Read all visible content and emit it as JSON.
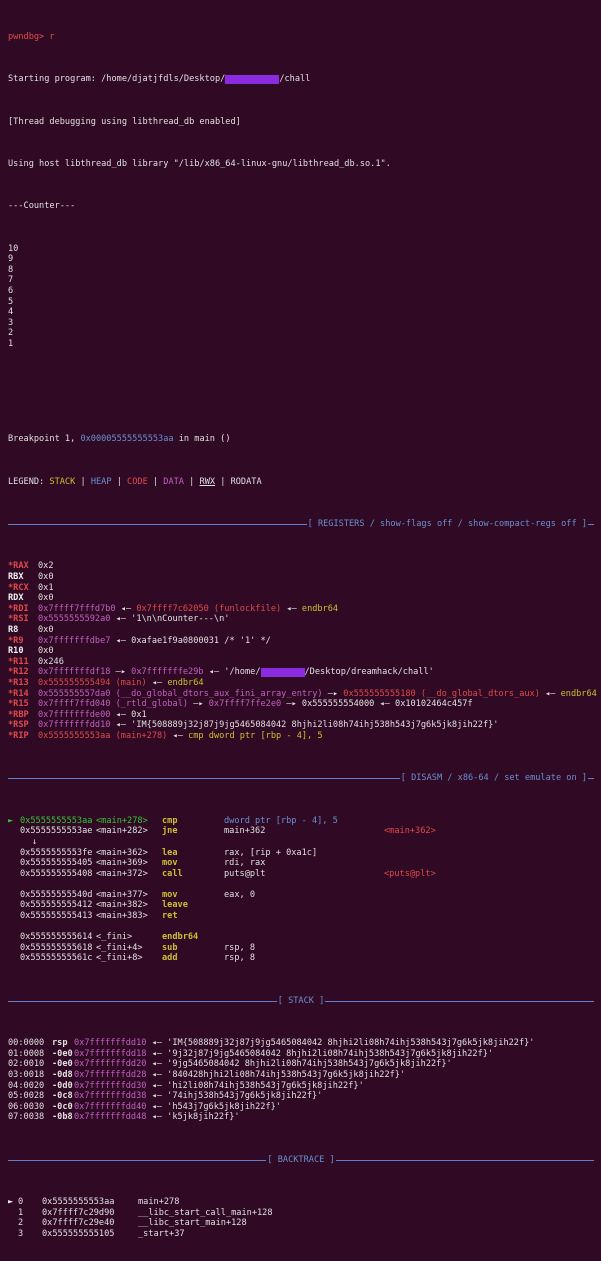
{
  "terminal": {
    "top_line": "pwndbg> r",
    "start_prefix": "Starting program: /home/djatjfdls/Desktop/",
    "start_suffix": "/chall",
    "thread_debug": "[Thread debugging using libthread_db enabled]",
    "host_libthread": "Using host libthread_db library \"/lib/x86_64-linux-gnu/libthread_db.so.1\".",
    "counter_header": "---Counter---",
    "counter_values": [
      "10",
      "9",
      "8",
      "7",
      "6",
      "5",
      "4",
      "3",
      "2",
      "1"
    ],
    "breakpoint_prefix": "Breakpoint 1, ",
    "breakpoint_addr": "0x00005555555553aa",
    "breakpoint_suffix": " in main ()",
    "legend_label": "LEGEND: ",
    "legend_items": [
      "STACK",
      "HEAP",
      "CODE",
      "DATA",
      "RWX",
      "RODATA"
    ]
  },
  "registers_header": "[ REGISTERS / show-flags off / show-compact-regs off ]",
  "registers": [
    {
      "name": "*RAX",
      "val": "0x2"
    },
    {
      "name": "RBX",
      "val": "0x0"
    },
    {
      "name": "*RCX",
      "val": "0x1"
    },
    {
      "name": "RDX",
      "val": "0x0"
    },
    {
      "name": "*RDI",
      "addr": "0x7ffff7fffd7b0",
      "arrow1": " ◂— ",
      "target": "0x7ffff7c62050 (funlockfile)",
      "arrow2": " ◂— ",
      "extra": "endbr64"
    },
    {
      "name": "*RSI",
      "addr": "0x5555555592a0",
      "arrow1": " ◂— ",
      "text": "'1\\n\\nCounter---\\n'"
    },
    {
      "name": "R8",
      "val": "0x0"
    },
    {
      "name": "*R9",
      "addr": "0x7fffffffdbe7",
      "arrow1": " ◂— ",
      "text": "0xafae1f9a0800031 /* '1' */"
    },
    {
      "name": "R10",
      "val": "0x0"
    },
    {
      "name": "*R11",
      "val": "0x246"
    },
    {
      "name": "*R12",
      "addr": "0x7fffffffdf18",
      "arrow1": " —▸ ",
      "target": "0x7fffffffe29b",
      "arrow2": " ◂— ",
      "text_prefix": "'/home/",
      "text_suffix": "/Desktop/dreamhack/chall'"
    },
    {
      "name": "*R13",
      "addr": "0x555555555494 (main)",
      "arrow1": " ◂— ",
      "extra": "endbr64"
    },
    {
      "name": "*R14",
      "addr": "0x555555557da0 (__do_global_dtors_aux_fini_array_entry)",
      "arrow1": " —▸ ",
      "target": "0x555555555180 (__do_global_dtors_aux)",
      "arrow2": " ◂— ",
      "extra": "endbr64"
    },
    {
      "name": "*R15",
      "addr": "0x7ffff7ffd040 (_rtld_global)",
      "arrow1": " —▸ ",
      "target": "0x7ffff7ffe2e0",
      "arrow2": " —▸ ",
      "text": "0x555555554000 ◂— 0x10102464c457f"
    },
    {
      "name": "*RBP",
      "addr": "0x7fffffffde00",
      "arrow1": " ◂— ",
      "text": "0x1"
    },
    {
      "name": "*RSP",
      "addr": "0x7fffffffdd10",
      "arrow1": " ◂— ",
      "text": "'IM{508889j32j87j9jg5465084042 8hjhi2li08h74ihj538h543j7g6k5jk8jih22f}'"
    },
    {
      "name": "*RIP",
      "addr": "0x5555555553aa (main+278)",
      "arrow1": " ◂— ",
      "extra": "cmp dword ptr [rbp - 4], 5"
    }
  ],
  "disasm_header": "[ DISASM / x86-64 / set emulate on ]",
  "disasm": [
    {
      "marker": "►",
      "addr": "0x5555555553aa",
      "sym": "<main+278>",
      "mn": "cmp",
      "op": "dword ptr [rbp - 4], 5",
      "note": ""
    },
    {
      "marker": "",
      "addr": "0x5555555553ae",
      "sym": "<main+282>",
      "mn": "jne",
      "op": "main+362",
      "note": "<main+362>"
    },
    {
      "marker": "↓",
      "addr": "",
      "sym": "",
      "mn": "",
      "op": "",
      "note": ""
    },
    {
      "marker": "",
      "addr": "0x5555555553fe",
      "sym": "<main+362>",
      "mn": "lea",
      "op": "rax, [rip + 0xa1c]",
      "note": ""
    },
    {
      "marker": "",
      "addr": "0x555555555405",
      "sym": "<main+369>",
      "mn": "mov",
      "op": "rdi, rax",
      "note": ""
    },
    {
      "marker": "",
      "addr": "0x555555555408",
      "sym": "<main+372>",
      "mn": "call",
      "op": "puts@plt",
      "note": "<puts@plt>"
    },
    {
      "marker": "",
      "addr": "",
      "sym": "",
      "mn": "",
      "op": "",
      "note": ""
    },
    {
      "marker": "",
      "addr": "0x55555555540d",
      "sym": "<main+377>",
      "mn": "mov",
      "op": "eax, 0",
      "note": ""
    },
    {
      "marker": "",
      "addr": "0x555555555412",
      "sym": "<main+382>",
      "mn": "leave",
      "op": "",
      "note": ""
    },
    {
      "marker": "",
      "addr": "0x555555555413",
      "sym": "<main+383>",
      "mn": "ret",
      "op": "",
      "note": ""
    },
    {
      "marker": "",
      "addr": "",
      "sym": "",
      "mn": "",
      "op": "",
      "note": ""
    },
    {
      "marker": "",
      "addr": "0x555555555614",
      "sym": "<_fini>",
      "mn": "endbr64",
      "op": "",
      "note": ""
    },
    {
      "marker": "",
      "addr": "0x555555555618",
      "sym": "<_fini+4>",
      "mn": "sub",
      "op": "rsp, 8",
      "note": ""
    },
    {
      "marker": "",
      "addr": "0x55555555561c",
      "sym": "<_fini+8>",
      "mn": "add",
      "op": "rsp, 8",
      "note": ""
    }
  ],
  "stack_header": "[ STACK ]",
  "stack": [
    {
      "idx": "00:0000",
      "reg": "rsp",
      "addr": "0x7fffffffdd10",
      "val": "'IM{508889j32j87j9jg5465084042 8hjhi2li08h74ihj538h543j7g6k5jk8jih22f}'"
    },
    {
      "idx": "01:0008",
      "reg": "-0e0",
      "addr": "0x7fffffffdd18",
      "val": "'9j32j87j9jg5465084042 8hjhi2li08h74ihj538h543j7g6k5jk8jih22f}'"
    },
    {
      "idx": "02:0010",
      "reg": "-0e0",
      "addr": "0x7fffffffdd20",
      "val": "'9jg5465084042 8hjhi2li08h74ihj538h543j7g6k5jk8jih22f}'"
    },
    {
      "idx": "03:0018",
      "reg": "-0d8",
      "addr": "0x7fffffffdd28",
      "val": "'840428hjhi2li08h74ihj538h543j7g6k5jk8jih22f}'"
    },
    {
      "idx": "04:0020",
      "reg": "-0d0",
      "addr": "0x7fffffffdd30",
      "val": "'hi2li08h74ihj538h543j7g6k5jk8jih22f}'"
    },
    {
      "idx": "05:0028",
      "reg": "-0c8",
      "addr": "0x7fffffffdd38",
      "val": "'74ihj538h543j7g6k5jk8jih22f}'"
    },
    {
      "idx": "06:0030",
      "reg": "-0c0",
      "addr": "0x7fffffffdd40",
      "val": "'h543j7g6k5jk8jih22f}'"
    },
    {
      "idx": "07:0038",
      "reg": "-0b8",
      "addr": "0x7fffffffdd48",
      "val": "'k5jk8jih22f}'"
    }
  ],
  "backtrace_header": "[ BACKTRACE ]",
  "backtrace": [
    {
      "marker": "►",
      "num": "0",
      "addr": "0x5555555553aa",
      "fn": "main+278"
    },
    {
      "marker": "",
      "num": "1",
      "addr": "0x7ffff7c29d90",
      "fn": "__libc_start_call_main+128"
    },
    {
      "marker": "",
      "num": "2",
      "addr": "0x7ffff7c29e40",
      "fn": "__libc_start_main+128"
    },
    {
      "marker": "",
      "num": "3",
      "addr": "0x555555555105",
      "fn": "_start+37"
    }
  ],
  "colors": {
    "background": "#300a24",
    "accent_blue": "#6a8fd0",
    "red": "#e0494b",
    "magenta": "#c060c0",
    "yellow": "#c8c030",
    "green": "#35c435",
    "redaction": "#8a2be2"
  }
}
